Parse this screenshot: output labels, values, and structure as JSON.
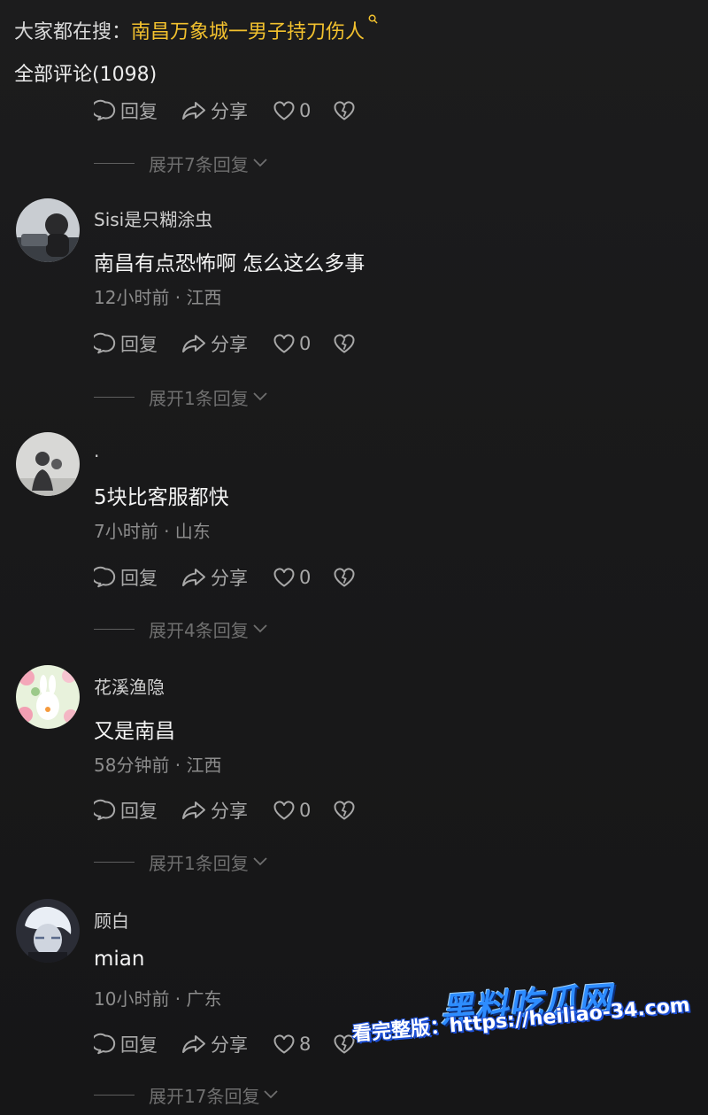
{
  "search": {
    "prefix": "大家都在搜：",
    "term": "南昌万象城一男子持刀伤人"
  },
  "comments_header": {
    "label": "全部评论(1098)"
  },
  "actions": {
    "reply": "回复",
    "share": "分享"
  },
  "first_thread": {
    "likes": "0",
    "expand": "展开7条回复"
  },
  "comments": [
    {
      "user": "Sisi是只糊涂虫",
      "text": "南昌有点恐怖啊 怎么这么多事",
      "meta": "12小时前 · 江西",
      "likes": "0",
      "expand": "展开1条回复"
    },
    {
      "user": ".",
      "text": "5块比客服都快",
      "meta": "7小时前 · 山东",
      "likes": "0",
      "expand": "展开4条回复"
    },
    {
      "user": "花溪渔隐",
      "text": "又是南昌",
      "meta": "58分钟前 · 江西",
      "likes": "0",
      "expand": "展开1条回复"
    },
    {
      "user": "顾白",
      "text": "mian",
      "meta": "10小时前 · 广东",
      "likes": "8",
      "expand": "展开17条回复"
    }
  ],
  "watermark": {
    "logo": "黑料吃瓜网",
    "line": "看完整版：https://heiliao-34.com"
  },
  "colors": {
    "background": "#1a1a1b",
    "search_term": "#f2c12e",
    "muted": "#8c8c8c"
  }
}
